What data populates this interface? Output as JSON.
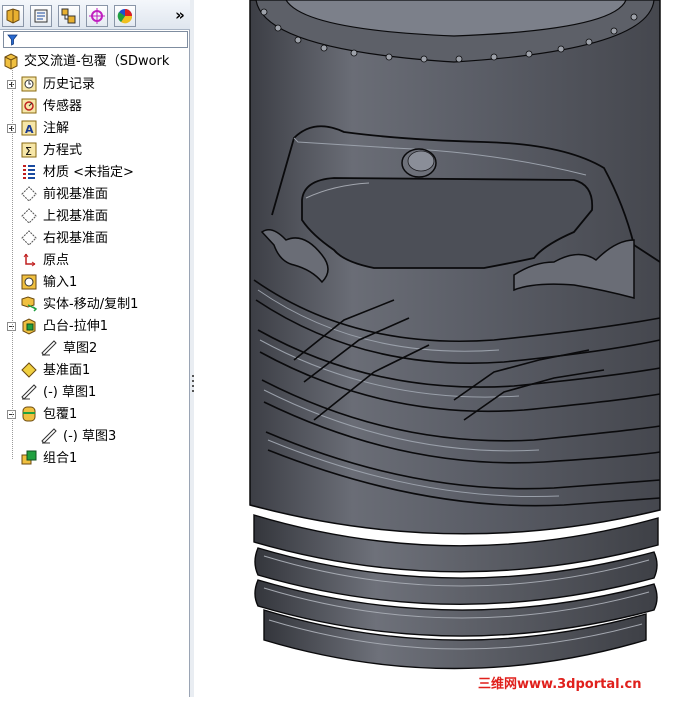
{
  "toolbar": {
    "tabs": [
      {
        "icon": "feature-manager-icon"
      },
      {
        "icon": "property-manager-icon"
      },
      {
        "icon": "configuration-manager-icon"
      },
      {
        "icon": "dimxpert-icon"
      },
      {
        "icon": "display-manager-icon"
      }
    ],
    "more_label": "»"
  },
  "filter": {
    "icon": "filter-icon",
    "value": ""
  },
  "tree": {
    "root": {
      "label": "交叉流道-包覆（SDwork",
      "icon": "part-icon"
    },
    "items": [
      {
        "label": "历史记录",
        "icon": "history-icon",
        "expander": "plus"
      },
      {
        "label": "传感器",
        "icon": "sensor-icon"
      },
      {
        "label": "注解",
        "icon": "annotation-icon",
        "expander": "plus"
      },
      {
        "label": "方程式",
        "icon": "equation-icon"
      },
      {
        "label": "材质 <未指定>",
        "icon": "material-icon"
      },
      {
        "label": "前视基准面",
        "icon": "plane-icon"
      },
      {
        "label": "上视基准面",
        "icon": "plane-icon"
      },
      {
        "label": "右视基准面",
        "icon": "plane-icon"
      },
      {
        "label": "原点",
        "icon": "origin-icon"
      },
      {
        "label": "输入1",
        "icon": "import-icon"
      },
      {
        "label": "实体-移动/复制1",
        "icon": "move-copy-body-icon"
      },
      {
        "label": "凸台-拉伸1",
        "icon": "boss-extrude-icon",
        "expander": "minus"
      },
      {
        "label": "草图2",
        "icon": "sketch-icon",
        "child": true
      },
      {
        "label": "基准面1",
        "icon": "reference-plane-icon"
      },
      {
        "label": "(-) 草图1",
        "icon": "sketch-icon"
      },
      {
        "label": "包覆1",
        "icon": "wrap-icon",
        "expander": "minus"
      },
      {
        "label": "(-) 草图3",
        "icon": "sketch-icon",
        "child": true
      },
      {
        "label": "组合1",
        "icon": "combine-icon"
      }
    ]
  },
  "viewport": {
    "model": "cylindrical-part-with-wrapped-grooves"
  },
  "watermark": {
    "text": "三维网www.3dportal.cn"
  },
  "colors": {
    "part_body": "#5a5d66",
    "part_edge": "#0a0a0c",
    "highlight": "#8a8e98",
    "panel_bg": "#ffffff",
    "watermark": "#e0201c"
  }
}
